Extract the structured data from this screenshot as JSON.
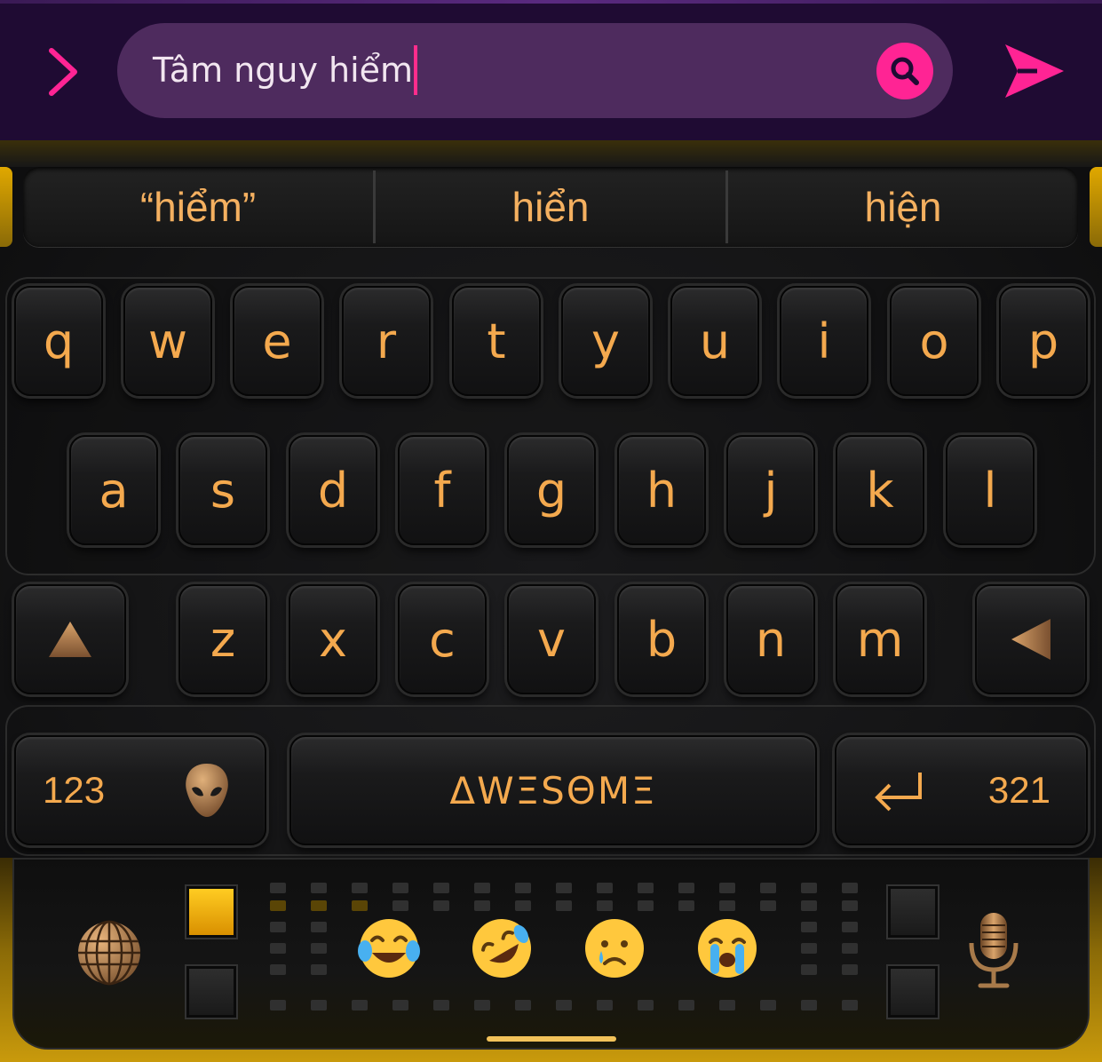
{
  "top_bar": {
    "input_value": "Tâm nguy hiểm"
  },
  "suggestions": [
    "“hiểm”",
    "hiển",
    "hiện"
  ],
  "keys": {
    "row1": [
      "q",
      "w",
      "e",
      "r",
      "t",
      "y",
      "u",
      "i",
      "o",
      "p"
    ],
    "row2": [
      "a",
      "s",
      "d",
      "f",
      "g",
      "h",
      "j",
      "k",
      "l"
    ],
    "row3": [
      "z",
      "x",
      "c",
      "v",
      "b",
      "n",
      "m"
    ],
    "numbers_label": "123",
    "space_label": "ΔWΞSΘMΞ",
    "reverse_numbers_label": "321"
  },
  "colors": {
    "key_text": "#f4a94e",
    "accent_pink": "#ff2494",
    "gold": "#e0a800",
    "top_bar_bg": "#1f0b33",
    "input_bg": "#4e2b5e"
  },
  "icons": {
    "expand": "chevron-right-icon",
    "search": "search-icon",
    "send": "send-icon",
    "shift": "shift-triangle-icon",
    "backspace": "backspace-triangle-icon",
    "emoji_key": "alien-icon",
    "enter": "enter-icon",
    "language": "globe-icon",
    "voice": "microphone-icon"
  },
  "emoji_bar": [
    "face-with-tears-of-joy",
    "rolling-on-the-floor-laughing",
    "crying-face",
    "loudly-crying-face"
  ]
}
